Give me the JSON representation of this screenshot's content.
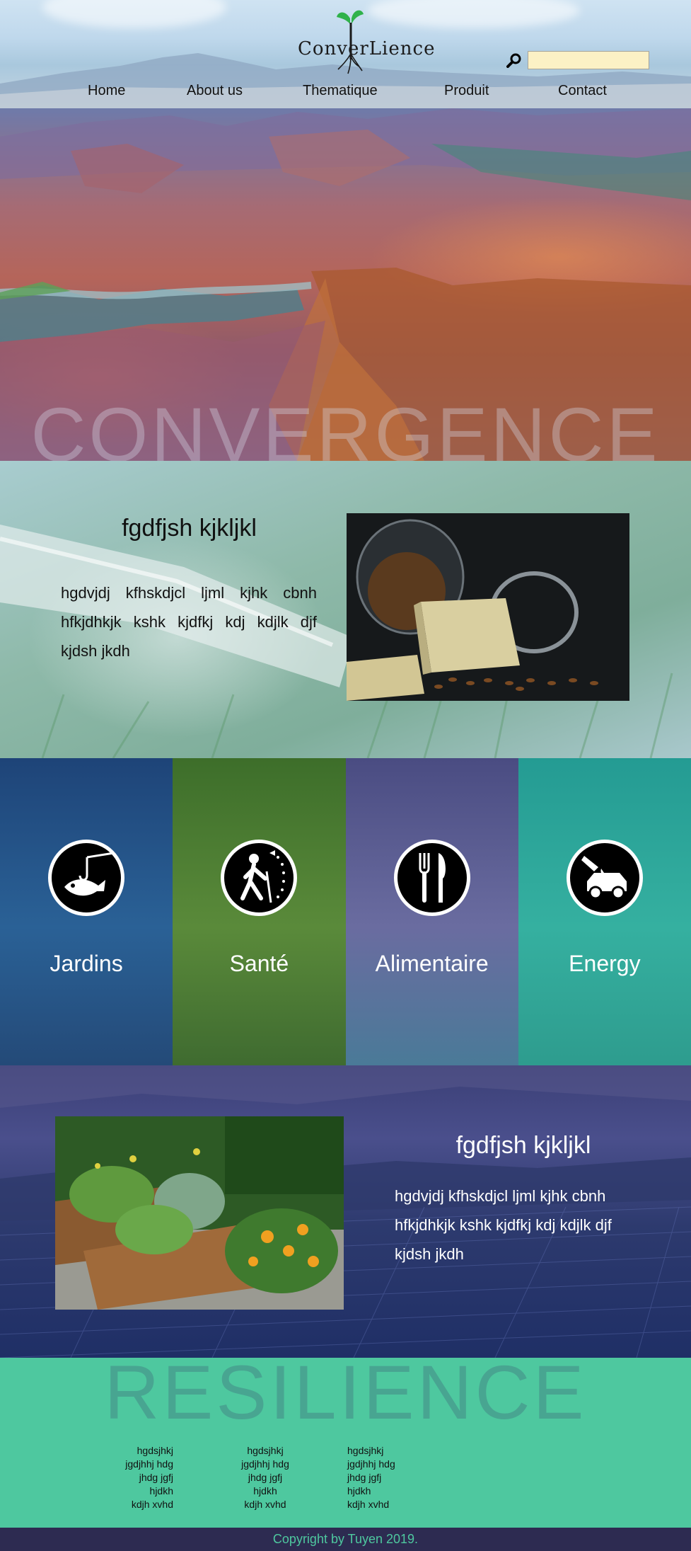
{
  "header": {
    "logo_text": "ConverLience",
    "search": {
      "placeholder": "",
      "value": ""
    },
    "nav": [
      "Home",
      "About us",
      "Thematique",
      "Produit",
      "Contact"
    ]
  },
  "hero": {
    "title": "CONVERGENCE"
  },
  "feature1": {
    "title": "fgdfjsh kjkljkl",
    "text": "hgdvjdj kfhskdjcl ljml kjhk cbnh hfkjdhkjk kshk kjdfkj kdj kdjlk djf kjdsh jkdh",
    "image": "cheese-and-grains-photo"
  },
  "categories": [
    {
      "label": "Jardins",
      "icon": "fishing-icon",
      "color": "#1f4f83"
    },
    {
      "label": "Santé",
      "icon": "hiking-icon",
      "color": "#4d7a33"
    },
    {
      "label": "Alimentaire",
      "icon": "fork-knife-icon",
      "color": "#5a5a8c"
    },
    {
      "label": "Energy",
      "icon": "car-fuel-icon",
      "color": "#2aa99a"
    }
  ],
  "feature2": {
    "title": "fgdfjsh kjkljkl",
    "text": "hgdvjdj kfhskdjcl ljml kjhk cbnh hfkjdhkjk kshk kjdfkj kdj kdjlk djf kjdsh jkdh",
    "image": "raised-garden-beds-photo"
  },
  "footer": {
    "title": "RESILIENCE",
    "columns": [
      [
        "hgdsjhkj",
        "jgdjhhj hdg",
        "jhdg jgfj",
        "hjdkh",
        "kdjh xvhd"
      ],
      [
        "hgdsjhkj",
        "jgdjhhj hdg",
        "jhdg jgfj",
        "hjdkh",
        "kdjh xvhd"
      ],
      [
        "hgdsjhkj",
        "jgdjhhj hdg",
        "jhdg jgfj",
        "hjdkh",
        "kdjh xvhd"
      ]
    ],
    "copyright": "Copyright by Tuyen 2019."
  },
  "colors": {
    "footer_bg": "#4ec89f",
    "copyright_bg": "#2d2b51",
    "search_bg": "#fcf1c5"
  }
}
